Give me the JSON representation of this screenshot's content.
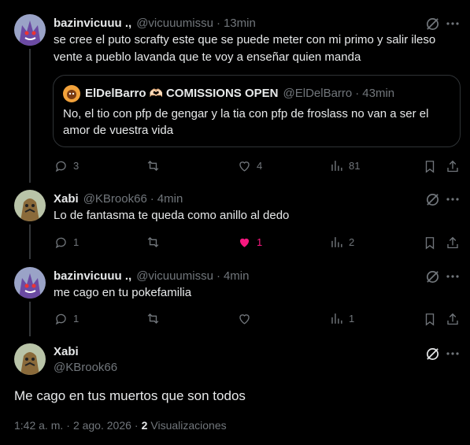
{
  "tweets": [
    {
      "name": "bazinvicuuu .,",
      "handle": "@vicuuumissu",
      "sep": "·",
      "time": "13min",
      "lines": [
        "se cree el puto scrafty este que se puede meter con mi primo y salir ileso",
        "vente a pueblo lavanda que te voy a enseñar quien manda"
      ],
      "replies": "3",
      "retweets": "",
      "likes": "4",
      "views": "81"
    },
    {
      "name": "Xabi",
      "handle": "@KBrook66",
      "sep": "·",
      "time": "4min",
      "lines": [
        "Lo de fantasma te queda como anillo al dedo"
      ],
      "replies": "1",
      "retweets": "",
      "likes": "1",
      "views": "2"
    },
    {
      "name": "bazinvicuuu .,",
      "handle": "@vicuuumissu",
      "sep": "·",
      "time": "4min",
      "lines": [
        "me cago en tu pokefamilia"
      ],
      "replies": "1",
      "retweets": "",
      "likes": "",
      "views": "1"
    }
  ],
  "quote": {
    "name": "ElDelBarro",
    "badge": "🫶🏻",
    "name_suffix": "COMISSIONS OPEN",
    "handle": "@ElDelBarro",
    "sep": "·",
    "time": "43min",
    "lines": [
      "No, el tio con pfp de gengar y la tia con pfp de froslass no van a ser el",
      "amor de vuestra vida"
    ]
  },
  "main_tweet": {
    "name": "Xabi",
    "handle": "@KBrook66",
    "text": "Me cago en tus muertos que son todos",
    "time": "1:42 a. m.",
    "sep": "·",
    "date": "2 ago. 2026",
    "sep2": "·",
    "views_count": "2",
    "views_label": "Visualizaciones"
  },
  "colors": {
    "background": "#000000",
    "text": "#e7e9ea",
    "muted": "#71767b",
    "border": "#2f3336",
    "like": "#f91880"
  }
}
